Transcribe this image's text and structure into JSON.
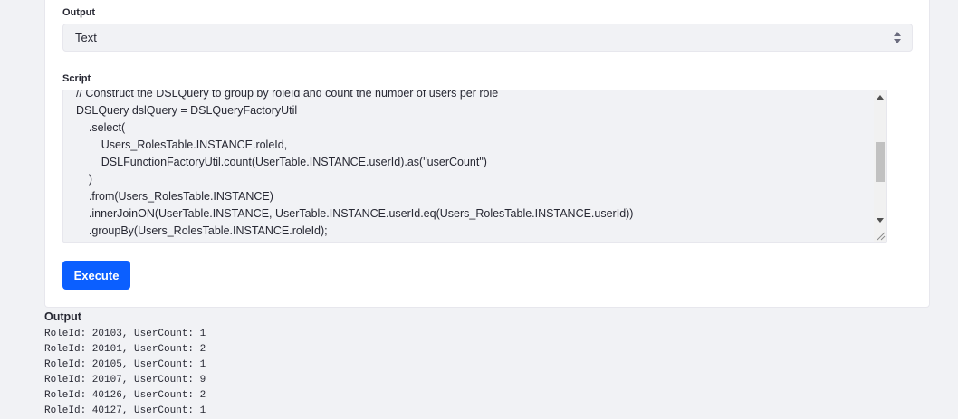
{
  "form": {
    "output_label": "Output",
    "output_select_value": "Text",
    "script_label": "Script",
    "script_lines": [
      "// Construct the DSLQuery to group by roleId and count the number of users per role",
      "DSLQuery dslQuery = DSLQueryFactoryUtil",
      "    .select(",
      "        Users_RolesTable.INSTANCE.roleId,",
      "        DSLFunctionFactoryUtil.count(UserTable.INSTANCE.userId).as(\"userCount\")",
      "    )",
      "    .from(Users_RolesTable.INSTANCE)",
      "    .innerJoinON(UserTable.INSTANCE, UserTable.INSTANCE.userId.eq(Users_RolesTable.INSTANCE.userId))",
      "    .groupBy(Users_RolesTable.INSTANCE.roleId);"
    ],
    "execute_label": "Execute"
  },
  "result": {
    "title": "Output",
    "lines": [
      "RoleId: 20103, UserCount: 1",
      "RoleId: 20101, UserCount: 2",
      "RoleId: 20105, UserCount: 1",
      "RoleId: 20107, UserCount: 9",
      "RoleId: 40126, UserCount: 2",
      "RoleId: 40127, UserCount: 1"
    ]
  },
  "colors": {
    "primary_button": "#0b5fff",
    "field_background": "#f1f2f5",
    "page_background": "#f1f2f5",
    "card_background": "#ffffff"
  },
  "icons": {
    "select_arrows": "caret-double-icon",
    "scroll_up": "scroll-up-arrow-icon",
    "scroll_down": "scroll-down-arrow-icon",
    "resize": "resize-grip-icon"
  }
}
